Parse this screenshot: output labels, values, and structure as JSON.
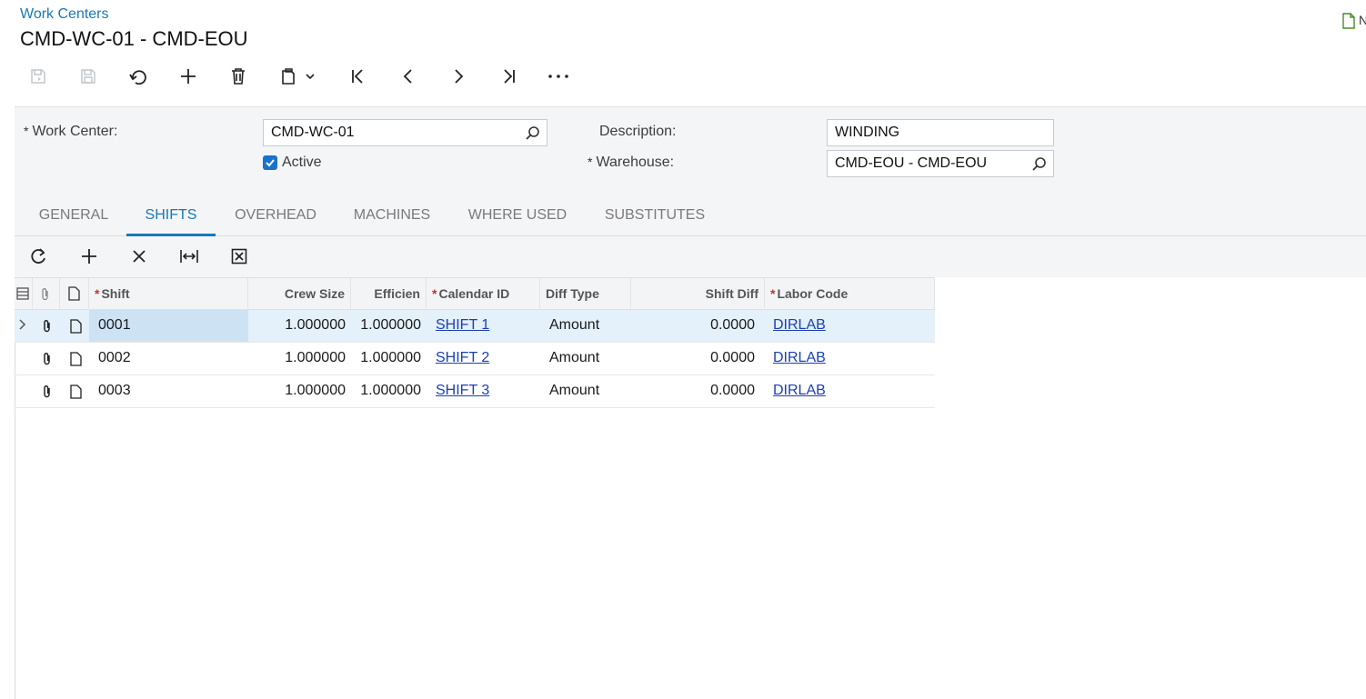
{
  "breadcrumb": "Work Centers",
  "page_title": "CMD-WC-01 - CMD-EOU",
  "notes_label": "N",
  "form": {
    "work_center_label": "Work Center:",
    "work_center_value": "CMD-WC-01",
    "active_label": "Active",
    "active_checked": true,
    "description_label": "Description:",
    "description_value": "WINDING",
    "warehouse_label": "Warehouse:",
    "warehouse_value": "CMD-EOU - CMD-EOU",
    "required_mark": "*"
  },
  "tabs": [
    {
      "label": "GENERAL",
      "active": false
    },
    {
      "label": "SHIFTS",
      "active": true
    },
    {
      "label": "OVERHEAD",
      "active": false
    },
    {
      "label": "MACHINES",
      "active": false
    },
    {
      "label": "WHERE USED",
      "active": false
    },
    {
      "label": "SUBSTITUTES",
      "active": false
    }
  ],
  "grid": {
    "columns": {
      "shift": "Shift",
      "crew_size": "Crew Size",
      "efficiency": "Efficien",
      "calendar_id": "Calendar ID",
      "diff_type": "Diff Type",
      "shift_diff": "Shift Diff",
      "labor_code": "Labor Code",
      "required_mark": "*"
    },
    "rows": [
      {
        "shift": "0001",
        "crew_size": "1.000000",
        "efficiency": "1.000000",
        "calendar_id": "SHIFT 1",
        "diff_type": "Amount",
        "shift_diff": "0.0000",
        "labor_code": "DIRLAB",
        "selected": true
      },
      {
        "shift": "0002",
        "crew_size": "1.000000",
        "efficiency": "1.000000",
        "calendar_id": "SHIFT 2",
        "diff_type": "Amount",
        "shift_diff": "0.0000",
        "labor_code": "DIRLAB",
        "selected": false
      },
      {
        "shift": "0003",
        "crew_size": "1.000000",
        "efficiency": "1.000000",
        "calendar_id": "SHIFT 3",
        "diff_type": "Amount",
        "shift_diff": "0.0000",
        "labor_code": "DIRLAB",
        "selected": false
      }
    ]
  },
  "colors": {
    "accent": "#1978b8",
    "link": "#1a3fb8",
    "selected_row": "#e4f0fa",
    "required_star": "#c0392b"
  },
  "icons": {
    "toolbar": [
      "save-close-icon",
      "save-icon",
      "undo-icon",
      "plus-icon",
      "trash-icon",
      "clipboard-icon",
      "chevron-down-icon",
      "first-record-icon",
      "previous-icon",
      "next-icon",
      "last-record-icon",
      "more-icon"
    ],
    "grid_toolbar": [
      "refresh-icon",
      "add-row-icon",
      "delete-row-icon",
      "fit-columns-icon",
      "excel-export-icon"
    ]
  }
}
